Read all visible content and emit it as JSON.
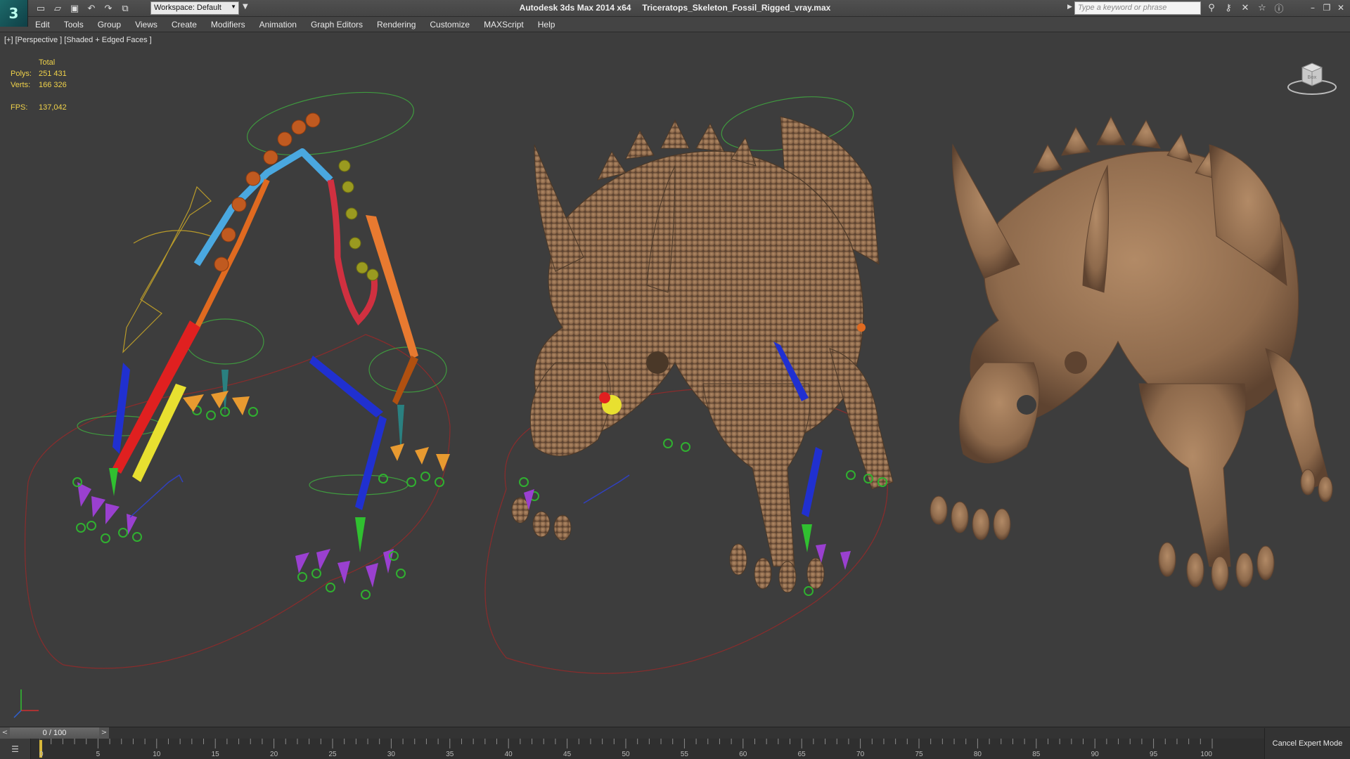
{
  "app": {
    "name": "Autodesk 3ds Max  2014 x64",
    "file": "Triceratops_Skeleton_Fossil_Rigged_vray.max",
    "logo_glyph": "3"
  },
  "toolbar": {
    "workspace_label": "Workspace: Default",
    "search_placeholder": "Type a keyword or phrase"
  },
  "menu": [
    "Edit",
    "Tools",
    "Group",
    "Views",
    "Create",
    "Modifiers",
    "Animation",
    "Graph Editors",
    "Rendering",
    "Customize",
    "MAXScript",
    "Help"
  ],
  "viewport": {
    "label": "[+] [Perspective ] [Shaded + Edged Faces ]",
    "stats": {
      "header": "Total",
      "polys_label": "Polys:",
      "polys_value": "251 431",
      "verts_label": "Verts:",
      "verts_value": "166 326",
      "fps_label": "FPS:",
      "fps_value": "137,042"
    },
    "viewcube_label": "Box"
  },
  "timeline": {
    "current": "0 / 100",
    "ticks": [
      "0",
      "5",
      "10",
      "15",
      "20",
      "25",
      "30",
      "35",
      "40",
      "45",
      "50",
      "55",
      "60",
      "65",
      "70",
      "75",
      "80",
      "85",
      "90",
      "95",
      "100"
    ]
  },
  "status": {
    "cancel_expert": "Cancel Expert Mode"
  },
  "colors": {
    "bone": "#9c7656",
    "stats_text": "#f0d24a",
    "viewport_bg": "#3d3d3d"
  },
  "icons": {
    "new": "new-file-icon",
    "open": "open-file-icon",
    "save": "save-icon",
    "undo": "undo-icon",
    "redo": "redo-icon",
    "project": "project-folder-icon",
    "binoculars": "binoculars-icon",
    "key": "key-icon",
    "star": "star-icon",
    "help": "help-icon"
  }
}
